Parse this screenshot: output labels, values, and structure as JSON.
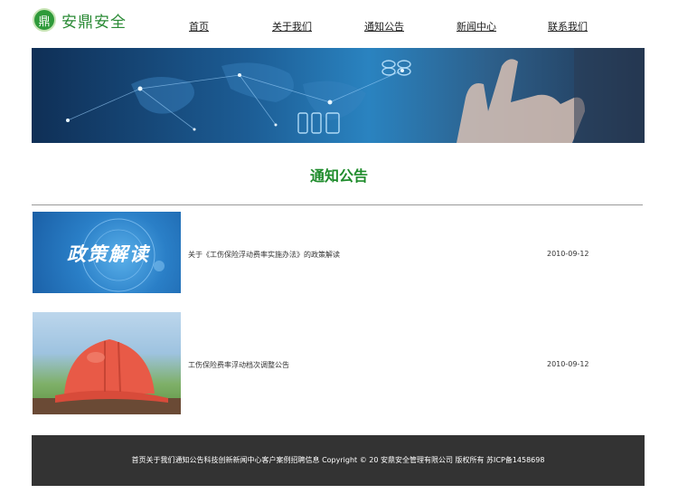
{
  "brand": {
    "logo_char": "鼎",
    "name": "安鼎安全",
    "color": "#2a8a35"
  },
  "nav": {
    "items": [
      {
        "label": "首页"
      },
      {
        "label": "关于我们"
      },
      {
        "label": "通知公告"
      },
      {
        "label": "新闻中心"
      },
      {
        "label": "联系我们"
      }
    ]
  },
  "section": {
    "title": "通知公告",
    "title_color": "#1f8c2c"
  },
  "notices": [
    {
      "title": "关于《工伤保险浮动费率实施办法》的政策解读",
      "date": "2010-09-12",
      "image_text": "政策解读",
      "image": "policy-banner"
    },
    {
      "title": "工伤保险费率浮动档次调整公告",
      "date": "2010-09-12",
      "image": "hard-hat-photo"
    }
  ],
  "footer": {
    "text": "首页关于我们通知公告科技创新新闻中心客户案例招聘信息 Copyright © 20 安鼎安全管理有限公司 版权所有 苏ICP备1458698",
    "background": "#333333"
  }
}
